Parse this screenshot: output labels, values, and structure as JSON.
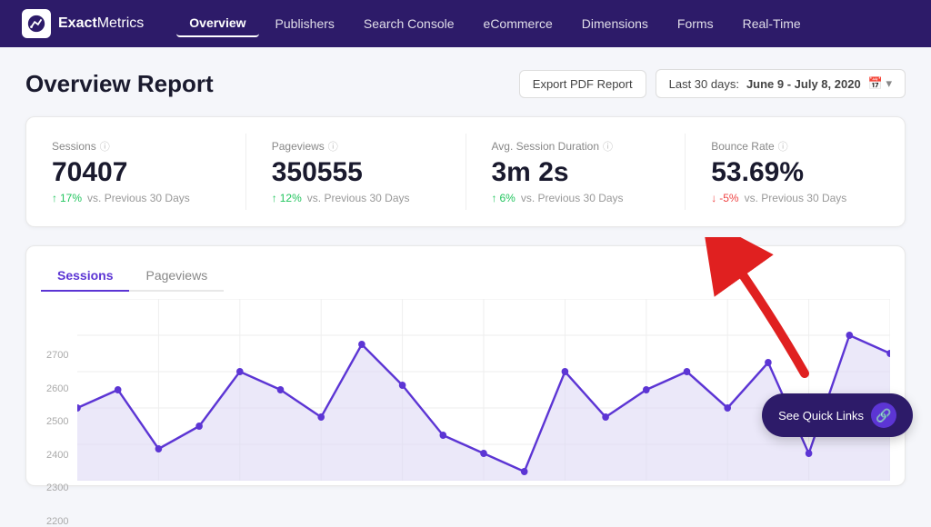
{
  "navbar": {
    "logo_text_bold": "Exact",
    "logo_text_light": "Metrics",
    "nav_items": [
      {
        "label": "Overview",
        "active": true
      },
      {
        "label": "Publishers",
        "active": false
      },
      {
        "label": "Search Console",
        "active": false
      },
      {
        "label": "eCommerce",
        "active": false
      },
      {
        "label": "Dimensions",
        "active": false
      },
      {
        "label": "Forms",
        "active": false
      },
      {
        "label": "Real-Time",
        "active": false
      }
    ]
  },
  "header": {
    "title": "Overview Report",
    "export_btn": "Export PDF Report",
    "date_prefix": "Last 30 days:",
    "date_range": "June 9 - July 8, 2020"
  },
  "stats": [
    {
      "label": "Sessions",
      "value": "70407",
      "change": "17%",
      "direction": "up",
      "vs_text": "vs. Previous 30 Days"
    },
    {
      "label": "Pageviews",
      "value": "350555",
      "change": "12%",
      "direction": "up",
      "vs_text": "vs. Previous 30 Days"
    },
    {
      "label": "Avg. Session Duration",
      "value": "3m 2s",
      "change": "6%",
      "direction": "up",
      "vs_text": "vs. Previous 30 Days"
    },
    {
      "label": "Bounce Rate",
      "value": "53.69%",
      "change": "-5%",
      "direction": "down",
      "vs_text": "vs. Previous 30 Days"
    }
  ],
  "tabs": [
    {
      "label": "Sessions",
      "active": true
    },
    {
      "label": "Pageviews",
      "active": false
    }
  ],
  "chart": {
    "y_labels": [
      "2700",
      "2600",
      "2500",
      "2400",
      "2300",
      "2200"
    ],
    "color": "#7c6fcd"
  },
  "quick_links": {
    "label": "See Quick Links"
  }
}
